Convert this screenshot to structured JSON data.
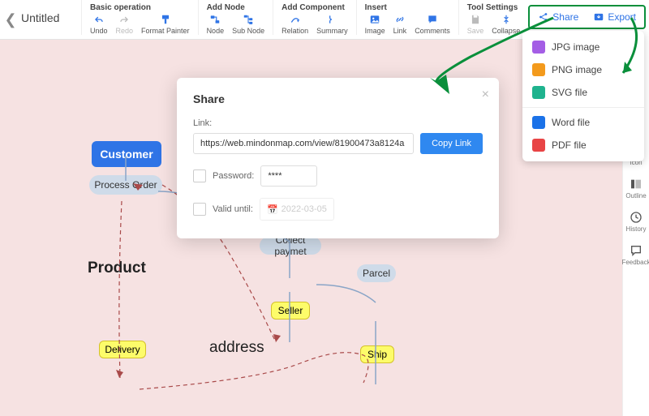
{
  "title": "Untitled",
  "toolbar": {
    "groups": [
      {
        "label": "Basic operation",
        "items": [
          {
            "label": "Undo",
            "icon": "undo-icon",
            "gray": false
          },
          {
            "label": "Redo",
            "icon": "redo-icon",
            "gray": true
          },
          {
            "label": "Format Painter",
            "icon": "format-painter-icon",
            "gray": false
          }
        ]
      },
      {
        "label": "Add Node",
        "items": [
          {
            "label": "Node",
            "icon": "node-icon",
            "gray": false
          },
          {
            "label": "Sub Node",
            "icon": "subnode-icon",
            "gray": false
          }
        ]
      },
      {
        "label": "Add Component",
        "items": [
          {
            "label": "Relation",
            "icon": "relation-icon",
            "gray": false
          },
          {
            "label": "Summary",
            "icon": "summary-icon",
            "gray": false
          }
        ]
      },
      {
        "label": "Insert",
        "items": [
          {
            "label": "Image",
            "icon": "image-icon",
            "gray": false
          },
          {
            "label": "Link",
            "icon": "link-icon",
            "gray": false
          },
          {
            "label": "Comments",
            "icon": "comments-icon",
            "gray": false
          }
        ]
      },
      {
        "label": "Tool Settings",
        "items": [
          {
            "label": "Save",
            "icon": "save-icon",
            "gray": true
          },
          {
            "label": "Collapse",
            "icon": "collapse-icon",
            "gray": false
          }
        ]
      }
    ],
    "right": {
      "share": "Share",
      "export": "Export"
    }
  },
  "side": {
    "items": [
      {
        "label": "Icon",
        "icon": "apps-icon"
      },
      {
        "label": "Outline",
        "icon": "outline-icon"
      },
      {
        "label": "History",
        "icon": "history-icon"
      },
      {
        "label": "Feedback",
        "icon": "feedback-icon"
      }
    ]
  },
  "export_menu": {
    "items": [
      {
        "label": "JPG image",
        "color": "#a45ee5"
      },
      {
        "label": "PNG image",
        "color": "#f39a1c"
      },
      {
        "label": "SVG file",
        "color": "#1fb38e"
      }
    ],
    "items2": [
      {
        "label": "Word file",
        "color": "#1b72e8"
      },
      {
        "label": "PDF file",
        "color": "#e84445"
      }
    ]
  },
  "share": {
    "title": "Share",
    "link_label": "Link:",
    "link_value": "https://web.mindonmap.com/view/81900473a8124a",
    "copy_label": "Copy Link",
    "password_label": "Password:",
    "password_value": "****",
    "valid_label": "Valid until:",
    "date_placeholder": "2022-03-05"
  },
  "mindmap": {
    "customer": "Customer",
    "process_order": "Process Order",
    "collect_payment": "Collect paymet",
    "parcel": "Parcel",
    "seller": "Seller",
    "delivery": "Delivery",
    "ship": "Ship",
    "product_label": "Product",
    "address_label": "address"
  }
}
